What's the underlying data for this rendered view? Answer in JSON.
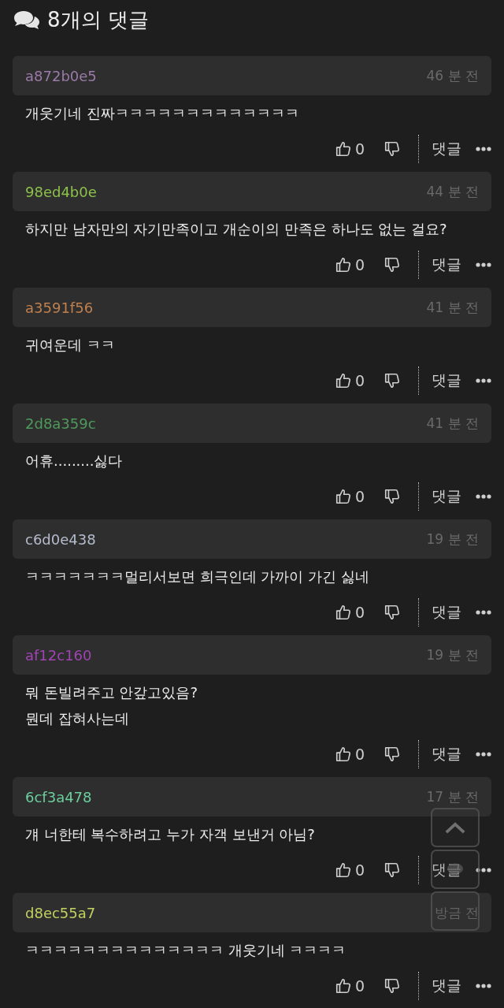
{
  "header": {
    "title": "8개의 댓글"
  },
  "comments": [
    {
      "author": "a872b0e5",
      "color": "#9a7aa8",
      "time": "46 분 전",
      "lines": [
        "개웃기네 진짜ㅋㅋㅋㅋㅋㅋㅋㅋㅋㅋㅋㅋㅋ"
      ],
      "likes": "0",
      "reply": "댓글"
    },
    {
      "author": "98ed4b0e",
      "color": "#8cc04a",
      "time": "44 분 전",
      "lines": [
        "하지만 남자만의 자기만족이고 개순이의 만족은 하나도 없는 걸요?"
      ],
      "likes": "0",
      "reply": "댓글"
    },
    {
      "author": "a3591f56",
      "color": "#c0804e",
      "time": "41 분 전",
      "lines": [
        "귀여운데 ㅋㅋ"
      ],
      "likes": "0",
      "reply": "댓글"
    },
    {
      "author": "2d8a359c",
      "color": "#4f9a5a",
      "time": "41 분 전",
      "lines": [
        "어휴.........싫다"
      ],
      "likes": "0",
      "reply": "댓글"
    },
    {
      "author": "c6d0e438",
      "color": "#b4bccc",
      "time": "19 분 전",
      "lines": [
        "ㅋㅋㅋㅋㅋㅋㅋ멀리서보면 희극인데 가까이 가긴 싫네"
      ],
      "likes": "0",
      "reply": "댓글"
    },
    {
      "author": "af12c160",
      "color": "#a044b4",
      "time": "19 분 전",
      "lines": [
        "뭐 돈빌려주고 안갚고있음?",
        "뭔데 잡혀사는데"
      ],
      "likes": "0",
      "reply": "댓글"
    },
    {
      "author": "6cf3a478",
      "color": "#6ccf9c",
      "time": "17 분 전",
      "lines": [
        "걔 너한테 복수하려고 누가 자객 보낸거 아님?"
      ],
      "likes": "0",
      "reply": "댓글"
    },
    {
      "author": "d8ec55a7",
      "color": "#c2d060",
      "time": "방금 전",
      "lines": [
        "ㅋㅋㅋㅋㅋㅋㅋㅋㅋㅋㅋㅋㅋㅋ 개웃기네 ㅋㅋㅋㅋ"
      ],
      "likes": "0",
      "reply": "댓글"
    }
  ]
}
